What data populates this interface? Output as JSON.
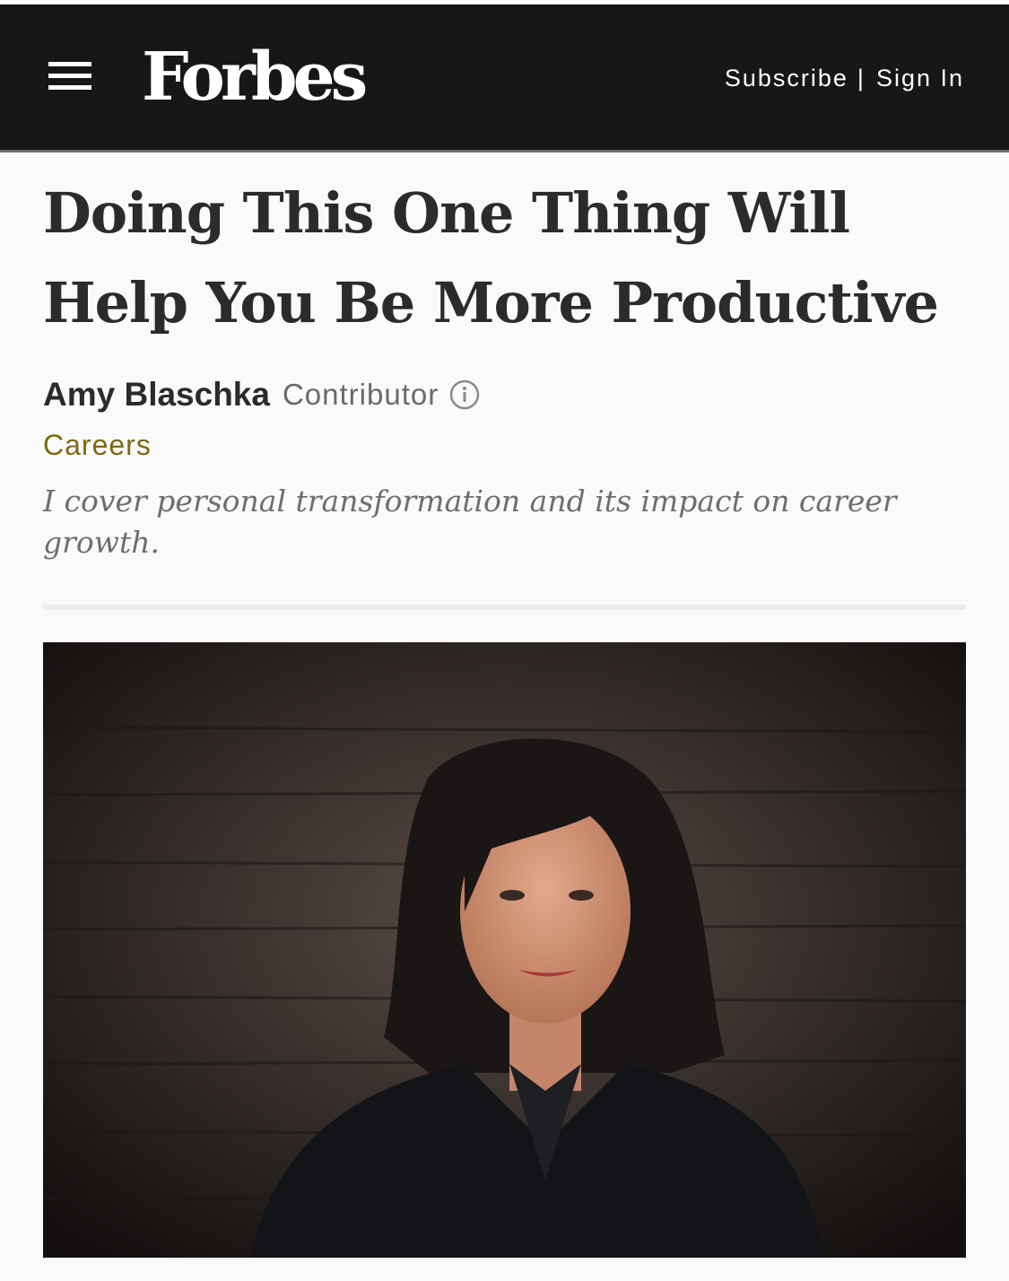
{
  "header": {
    "logo": "Forbes",
    "subscribe_label": "Subscribe",
    "separator": "|",
    "sign_in_label": "Sign In"
  },
  "article": {
    "title": "Doing This One Thing Will Help You Be More Productive",
    "author": "Amy Blaschka",
    "author_role": "Contributor",
    "category": "Careers",
    "author_bio": "I cover personal transformation and its impact on career growth."
  },
  "icons": {
    "menu": "hamburger-menu-icon",
    "info": "info-circle-icon"
  },
  "colors": {
    "header_bg": "#181716",
    "category": "#7d6a10",
    "title": "#2b2b2b"
  }
}
